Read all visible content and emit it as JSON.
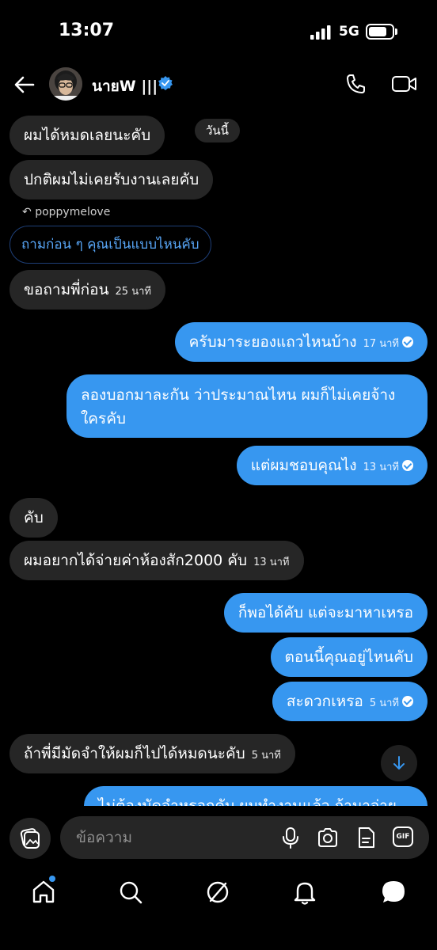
{
  "status": {
    "time": "13:07",
    "network": "5G",
    "battery_level": 0.78
  },
  "header": {
    "contact_name": "นายW |||",
    "verified": true,
    "icons": [
      "back-arrow-icon",
      "verified-badge-icon",
      "phone-call-icon",
      "video-call-icon"
    ]
  },
  "day_divider": "วันนี้",
  "reply_context": {
    "label": "poppymelove",
    "quoted_text": "ถามก่อน ๆ คุณเป็นแบบไหนคับ"
  },
  "messages": [
    {
      "side": "in",
      "text": "ผมได้หมดเลยนะคับ",
      "time": ""
    },
    {
      "side": "in",
      "text": "ปกติผมไม่เคยรับงานเลยคับ",
      "time": ""
    },
    {
      "side": "in",
      "text": "ขอถามพี่ก่อน",
      "time": "25 นาที"
    },
    {
      "side": "out",
      "text": "ครับมาระยองแถวไหนบ้าง",
      "time": "17 นาที"
    },
    {
      "side": "out",
      "text": "ลองบอกมาละกัน ว่าประมาณไหน ผมก็ไม่เคยจ้างใครคับ",
      "time": ""
    },
    {
      "side": "out",
      "text": "แต่ผมชอบคุณไง",
      "time": "13 นาที"
    },
    {
      "side": "in",
      "text": "คับ",
      "time": ""
    },
    {
      "side": "in",
      "text": "ผมอยากได้จ่ายค่าห้องสัก2000 คับ",
      "time": "13 นาที"
    },
    {
      "side": "out",
      "text": "ก็พอได้คับ แต่จะมาหาเหรอ",
      "time": ""
    },
    {
      "side": "out",
      "text": "ตอนนี้คุณอยู่ไหนคับ",
      "time": ""
    },
    {
      "side": "out",
      "text": "สะดวกเหรอ",
      "time": "5 นาที"
    },
    {
      "side": "in",
      "text": "ถ้าพี่มีมัดจำให้ผมก็ไปได้หมดนะคับ",
      "time": "5 นาที"
    },
    {
      "side": "out",
      "text": "ไม่ต้องมัดจำหรอกคับ ผมทำงานแล้ว ถ้ามาจ่าย",
      "time": ""
    }
  ],
  "composer": {
    "placeholder": "ข้อความ",
    "icons": [
      "gallery-icon",
      "microphone-icon",
      "camera-icon",
      "sticker-icon",
      "gif-icon"
    ],
    "gif_label": "GIF"
  },
  "nav": {
    "items": [
      "home-icon",
      "search-icon",
      "explore-icon",
      "notifications-icon",
      "messages-icon"
    ]
  }
}
